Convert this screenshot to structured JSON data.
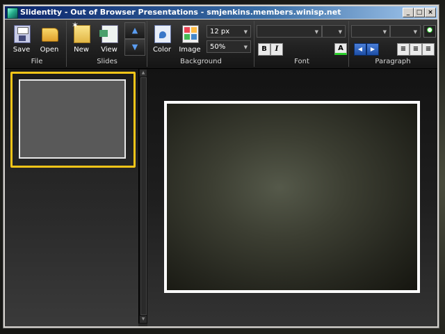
{
  "window": {
    "title": "Slidentity - Out of Browser Presentations - smjenkins.members.winisp.net",
    "controls": {
      "minimize": "_",
      "maximize": "□",
      "close": "×"
    }
  },
  "ribbon": {
    "file": {
      "label": "File",
      "save": "Save",
      "open": "Open"
    },
    "slides": {
      "label": "Slides",
      "new": "New",
      "view": "View",
      "up_icon": "▲",
      "down_icon": "▼"
    },
    "background": {
      "label": "Background",
      "color": "Color",
      "image": "Image",
      "font_size": "12 px",
      "zoom": "50%"
    },
    "font": {
      "label": "Font",
      "family": "",
      "size": "",
      "bold": "B",
      "italic": "I",
      "color_letter": "A",
      "color_accent": "#2bd12b"
    },
    "paragraph": {
      "label": "Paragraph",
      "list_style": "",
      "spacing": "",
      "indent_left_icon": "◀",
      "indent_right_icon": "▶",
      "align_left_icon": "≡",
      "align_center_icon": "≡",
      "align_right_icon": "≡"
    }
  },
  "colors": {
    "selection": "#f5c518",
    "accent_blue": "#3a78c8"
  }
}
